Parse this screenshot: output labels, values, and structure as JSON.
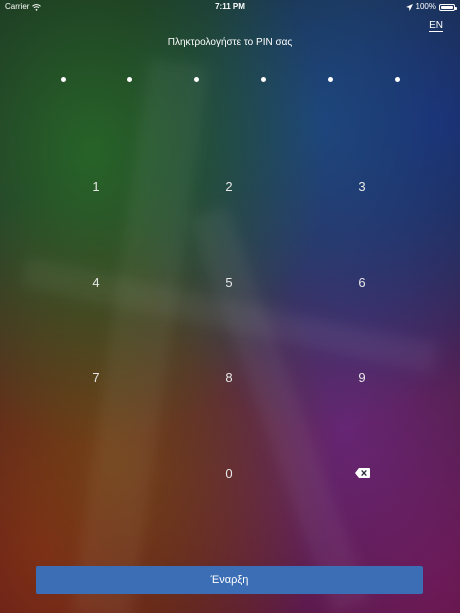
{
  "status_bar": {
    "carrier": "Carrier",
    "time": "7:11 PM",
    "battery": "100%",
    "icons": [
      "wifi-icon",
      "location-arrow-icon",
      "battery-icon"
    ]
  },
  "language_toggle": "EN",
  "prompt": "Πληκτρολογήστε το PIN σας",
  "pin": {
    "length": 6,
    "entered": 0
  },
  "keypad": {
    "keys": [
      "1",
      "2",
      "3",
      "4",
      "5",
      "6",
      "7",
      "8",
      "9",
      "0"
    ],
    "backspace_icon": "backspace-icon"
  },
  "start_button": {
    "label": "Έναρξη",
    "color": "#3b6eb5"
  }
}
